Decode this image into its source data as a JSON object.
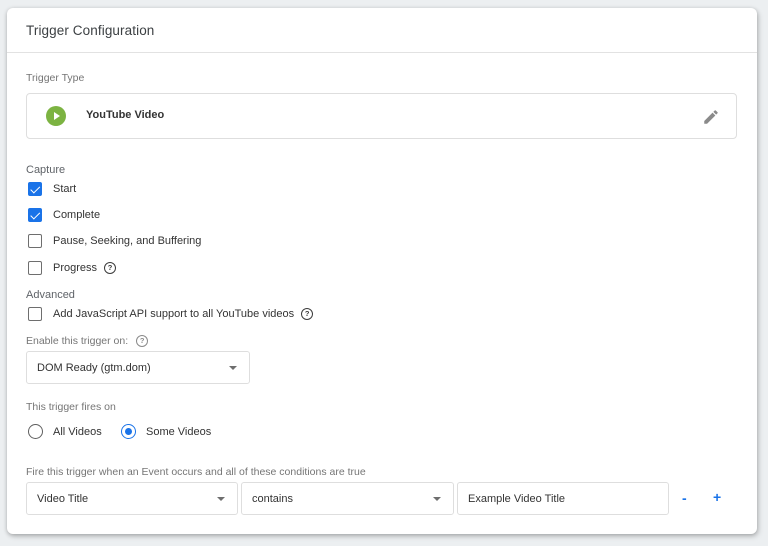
{
  "card": {
    "title": "Trigger Configuration"
  },
  "trigger_type": {
    "label": "Trigger Type",
    "name": "YouTube Video",
    "icon": "play-circle-icon",
    "icon_color": "#7cb342",
    "edit_icon": "pencil-icon"
  },
  "capture": {
    "heading": "Capture",
    "options": [
      {
        "label": "Start",
        "checked": true
      },
      {
        "label": "Complete",
        "checked": true
      },
      {
        "label": "Pause, Seeking, and Buffering",
        "checked": false
      },
      {
        "label": "Progress",
        "checked": false,
        "help": true
      }
    ]
  },
  "advanced": {
    "heading": "Advanced",
    "js_api_label": "Add JavaScript API support to all YouTube videos",
    "js_api_checked": false
  },
  "enable_on": {
    "label": "Enable this trigger on:",
    "selected": "DOM Ready (gtm.dom)"
  },
  "fires_on": {
    "label": "This trigger fires on",
    "options": [
      {
        "label": "All Videos",
        "selected": false
      },
      {
        "label": "Some Videos",
        "selected": true
      }
    ]
  },
  "conditions": {
    "label": "Fire this trigger when an Event occurs and all of these conditions are true",
    "variable": "Video Title",
    "operator": "contains",
    "value": "Example Video Title",
    "remove_label": "-",
    "add_label": "+"
  },
  "colors": {
    "accent": "#1a73e8",
    "youtube_icon": "#7cb342"
  }
}
